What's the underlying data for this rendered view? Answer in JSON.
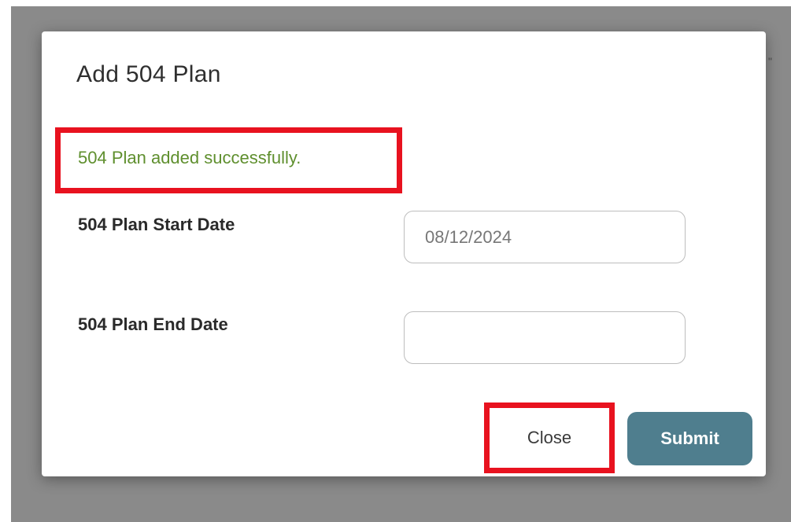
{
  "background": {
    "peek_text": "\""
  },
  "modal": {
    "title": "Add 504 Plan",
    "success_message": "504 Plan added successfully.",
    "start_date": {
      "label": "504 Plan Start Date",
      "value": "08/12/2024"
    },
    "end_date": {
      "label": "504 Plan End Date",
      "value": ""
    },
    "buttons": {
      "close_label": "Close",
      "submit_label": "Submit"
    }
  },
  "colors": {
    "highlight": "#e8121f",
    "success_text": "#5f8f2e",
    "submit_bg": "#4f7e8e",
    "overlay": "#8a8a8a"
  }
}
